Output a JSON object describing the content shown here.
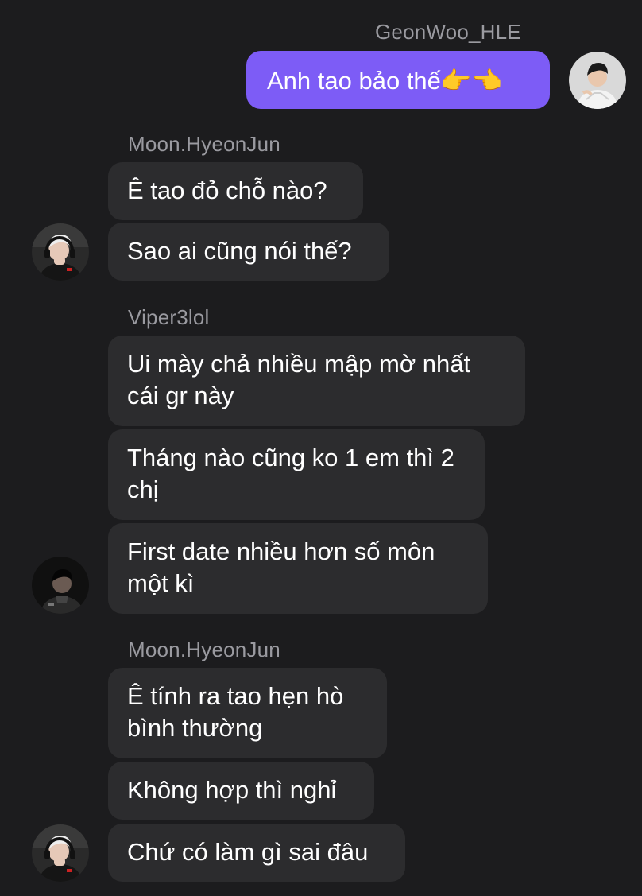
{
  "chat": {
    "names": {
      "geonwoo": "GeonWoo_HLE",
      "moon1": "Moon.HyeonJun",
      "viper": "Viper3lol",
      "moon2": "Moon.HyeonJun"
    },
    "messages": {
      "m1": "Anh tao bảo thế👉👈",
      "m2": "Ê tao đỏ chỗ nào?",
      "m3": "Sao ai cũng nói thế?",
      "m4": "Ui mày chả nhiều mập mờ nhất cái gr này",
      "m5": "Tháng nào cũng ko 1 em thì 2 chị",
      "m6": "First date nhiều hơn số môn một kì",
      "m7": "Ê tính ra tao hẹn hò bình thường",
      "m8": "Không hợp thì nghỉ",
      "m9": "Chứ có làm gì sai đâu"
    }
  },
  "colors": {
    "background": "#1c1c1e",
    "incoming_bubble": "#2c2c2e",
    "outgoing_bubble": "#7d5cf6",
    "sender_name": "#9a9aa0"
  },
  "icons": {
    "avatar_geonwoo": "person-avatar-light",
    "avatar_moon": "person-avatar-headset",
    "avatar_viper": "person-avatar-dark"
  }
}
